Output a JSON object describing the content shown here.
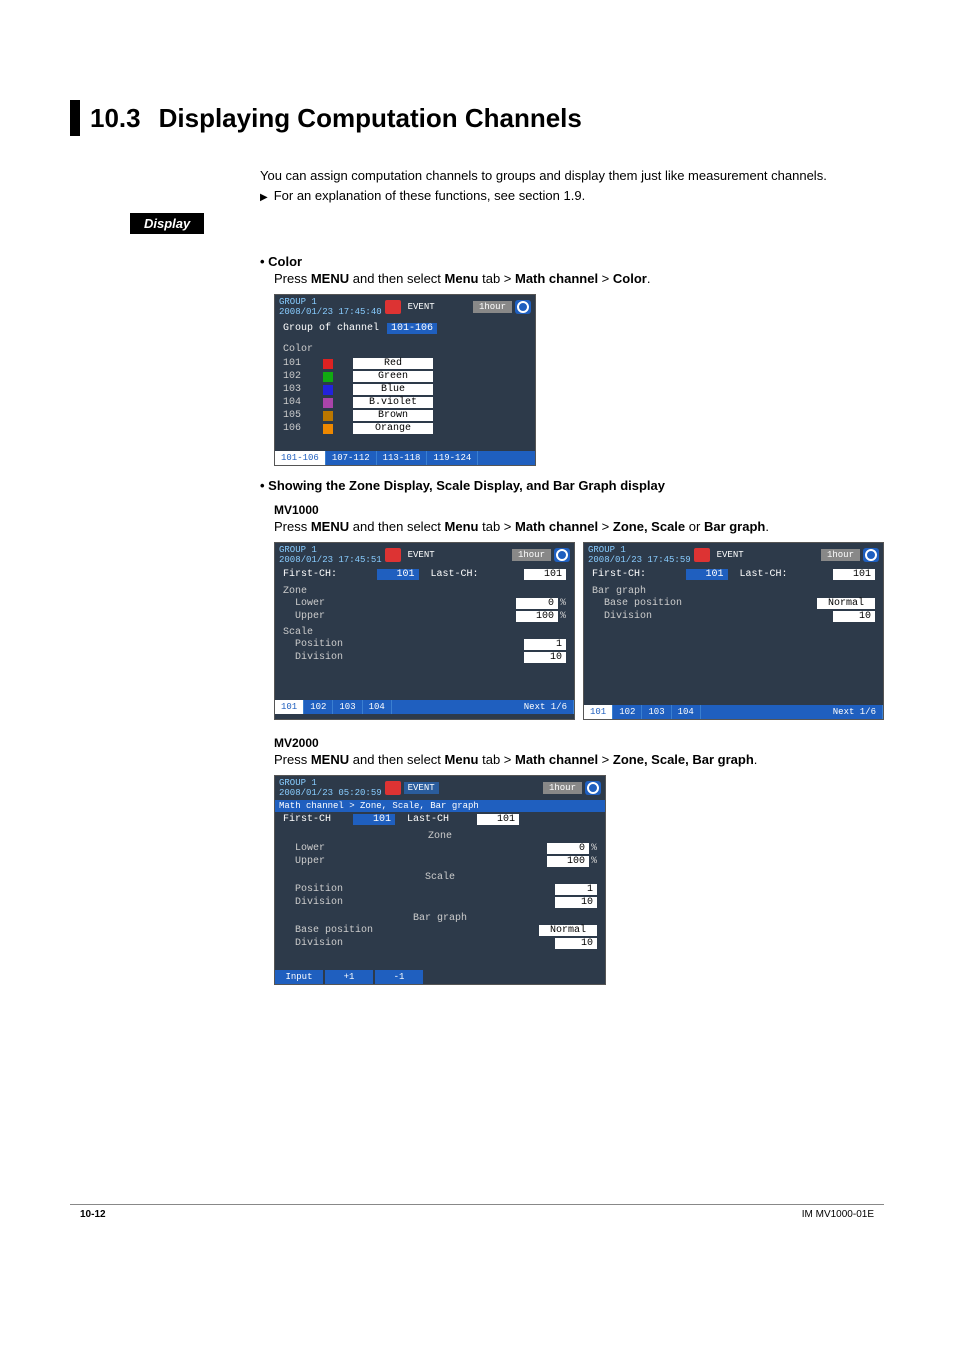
{
  "section": {
    "number": "10.3",
    "title": "Displaying Computation Channels"
  },
  "intro": {
    "p1": "You can assign computation channels to groups and display them just like measurement channels.",
    "p2": "For an explanation of these functions, see section 1.9."
  },
  "display_tag": "Display",
  "block_color": {
    "heading": "Color",
    "instr_prefix": "Press ",
    "instr_menu": "MENU",
    "instr_mid": " and then select ",
    "instr_menu_tab": "Menu",
    "instr_tab": " tab > ",
    "instr_math": "Math channel",
    "instr_gt": " > ",
    "instr_target": "Color",
    "instr_suffix": "."
  },
  "panel_color": {
    "group": "GROUP 1",
    "datetime": "2008/01/23 17:45:40",
    "event": "EVENT",
    "hour": "1hour",
    "group_of_channel_label": "Group of channel",
    "group_of_channel_value": "101-106",
    "section": "Color",
    "rows": [
      {
        "id": "101",
        "sw": "#d22",
        "name": "Red"
      },
      {
        "id": "102",
        "sw": "#1a1",
        "name": "Green"
      },
      {
        "id": "103",
        "sw": "#22d",
        "name": "Blue"
      },
      {
        "id": "104",
        "sw": "#a4a",
        "name": "B.violet"
      },
      {
        "id": "105",
        "sw": "#b70",
        "name": "Brown"
      },
      {
        "id": "106",
        "sw": "#e80",
        "name": "Orange"
      }
    ],
    "tabs": [
      "101-106",
      "107-112",
      "113-118",
      "119-124"
    ]
  },
  "block_zone": {
    "heading": "Showing the Zone Display, Scale Display, and Bar Graph display",
    "model1": "MV1000",
    "instr1_target": "Zone, Scale",
    "instr1_or": " or ",
    "instr1_target2": "Bar graph",
    "model2": "MV2000",
    "instr2_target": "Zone, Scale, Bar graph"
  },
  "panel_zone_left": {
    "group": "GROUP 1",
    "datetime": "2008/01/23 17:45:51",
    "event": "EVENT",
    "hour": "1hour",
    "first_ch_label": "First-CH:",
    "first_ch_value": "101",
    "last_ch_label": "Last-CH:",
    "last_ch_value": "101",
    "zone_label": "Zone",
    "lower_label": "Lower",
    "lower_value": "0",
    "upper_label": "Upper",
    "upper_value": "100",
    "pct": "%",
    "scale_label": "Scale",
    "position_label": "Position",
    "position_value": "1",
    "division_label": "Division",
    "division_value": "10",
    "tabs": [
      "101",
      "102",
      "103",
      "104"
    ],
    "next": "Next 1/6"
  },
  "panel_zone_right": {
    "group": "GROUP 1",
    "datetime": "2008/01/23 17:45:59",
    "event": "EVENT",
    "hour": "1hour",
    "first_ch_label": "First-CH:",
    "first_ch_value": "101",
    "last_ch_label": "Last-CH:",
    "last_ch_value": "101",
    "bar_label": "Bar graph",
    "base_label": "Base position",
    "base_value": "Normal",
    "division_label": "Division",
    "division_value": "10",
    "tabs": [
      "101",
      "102",
      "103",
      "104"
    ],
    "next": "Next 1/6"
  },
  "panel_mv2000": {
    "group": "GROUP 1",
    "datetime": "2008/01/23 05:20:59",
    "event": "EVENT",
    "hour": "1hour",
    "breadcrumb": "Math channel > Zone, Scale, Bar graph",
    "first_ch_label": "First-CH",
    "first_ch_value": "101",
    "last_ch_label": "Last-CH",
    "last_ch_value": "101",
    "zone_label": "Zone",
    "lower_label": "Lower",
    "lower_value": "0",
    "upper_label": "Upper",
    "upper_value": "100",
    "pct": "%",
    "scale_label": "Scale",
    "position_label": "Position",
    "position_value": "1",
    "division_label": "Division",
    "division_value": "10",
    "bar_label": "Bar graph",
    "base_label": "Base position",
    "base_value": "Normal",
    "bar_division_label": "Division",
    "bar_division_value": "10",
    "tabs": [
      "Input",
      "+1",
      "-1"
    ]
  },
  "footer": {
    "page": "10-12",
    "doc": "IM MV1000-01E"
  }
}
